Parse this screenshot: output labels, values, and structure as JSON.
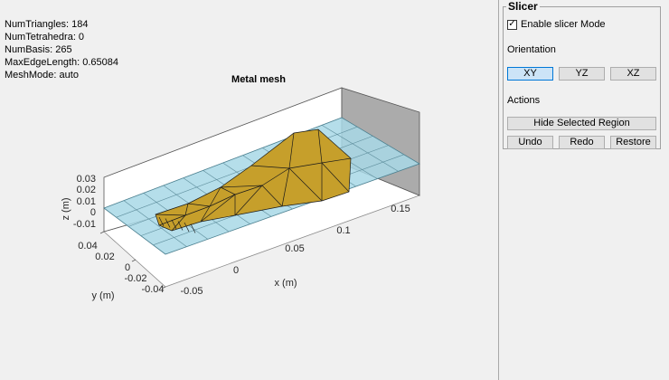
{
  "mesh_info": {
    "lines": [
      "NumTriangles: 184",
      "NumTetrahedra: 0",
      "NumBasis: 265",
      "MaxEdgeLength: 0.65084",
      "MeshMode: auto"
    ]
  },
  "plot": {
    "title": "Metal mesh",
    "xlabel": "x (m)",
    "ylabel": "y (m)",
    "zlabel": "z (m)",
    "x_ticks": [
      "-0.05",
      "0",
      "0.05",
      "0.1",
      "0.15"
    ],
    "y_ticks": [
      "0.04",
      "0.02",
      "0",
      "-0.02",
      "-0.04"
    ],
    "z_ticks": [
      "0.03",
      "0.02",
      "0.01",
      "0",
      "-0.01"
    ],
    "colors": {
      "metal": "#c69f2b",
      "substrate": "#a8d8e6",
      "wall": "#ababab"
    }
  },
  "slicer": {
    "title": "Slicer",
    "enable_label": "Enable slicer Mode",
    "enable_checked": true,
    "checkmark": "✓",
    "orientation_label": "Orientation",
    "orientations": [
      "XY",
      "YZ",
      "XZ"
    ],
    "selected_orientation": "XY",
    "actions_label": "Actions",
    "hide_label": "Hide Selected Region",
    "undo_label": "Undo",
    "redo_label": "Redo",
    "restore_label": "Restore"
  }
}
